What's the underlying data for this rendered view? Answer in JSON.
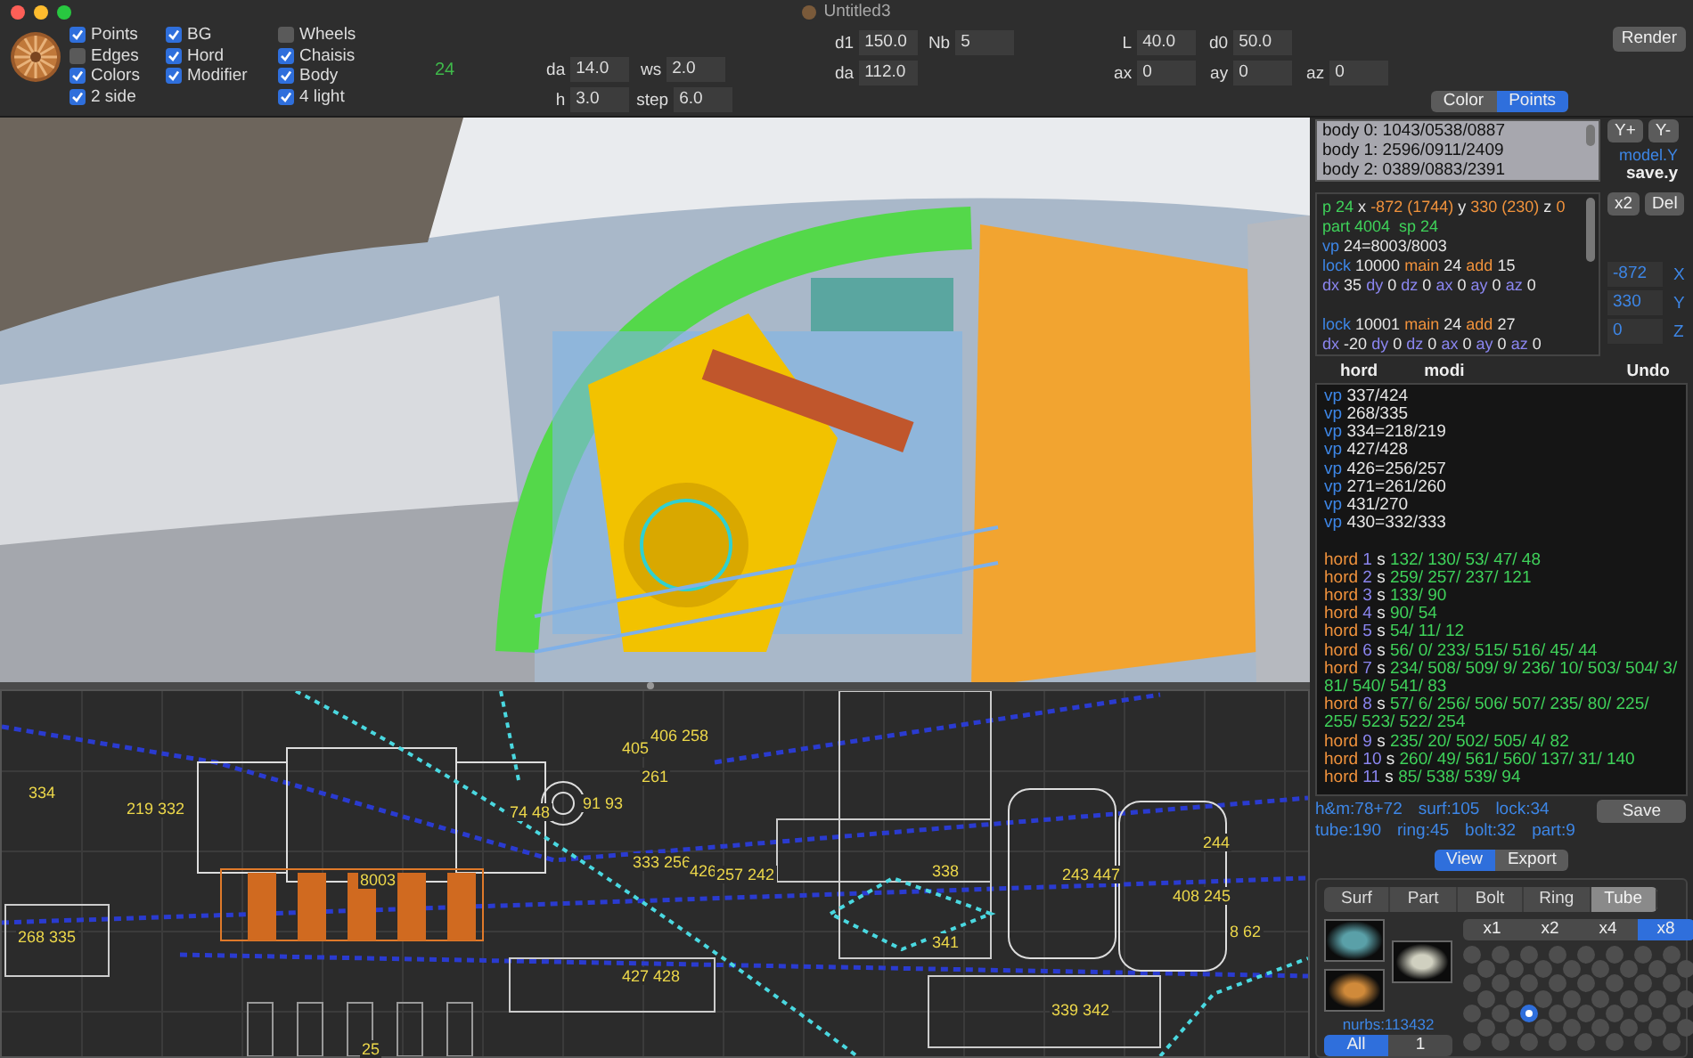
{
  "window": {
    "title": "Untitled3"
  },
  "toolbar": {
    "checkbox_columns": [
      [
        {
          "label": "Points",
          "checked": true
        },
        {
          "label": "Edges",
          "checked": false
        },
        {
          "label": "Colors",
          "checked": true
        },
        {
          "label": "2 side",
          "checked": true
        }
      ],
      [
        {
          "label": "BG",
          "checked": true
        },
        {
          "label": "Hord",
          "checked": true
        },
        {
          "label": "Modifier",
          "checked": true
        }
      ],
      [
        {
          "label": "Wheels",
          "checked": false
        },
        {
          "label": "Chaisis",
          "checked": true
        },
        {
          "label": "Body",
          "checked": true
        },
        {
          "label": "4 light",
          "checked": true
        }
      ]
    ],
    "count": "24",
    "field_groups": [
      {
        "rows": [
          [
            {
              "label": "da",
              "value": "14.0"
            },
            {
              "label": "ws",
              "value": "2.0"
            }
          ],
          [
            {
              "label": "h",
              "value": "3.0"
            },
            {
              "label": "step",
              "value": "6.0"
            }
          ]
        ]
      },
      {
        "rows": [
          [
            {
              "label": "d1",
              "value": "150.0"
            },
            {
              "label": "Nb",
              "value": "5"
            }
          ],
          [
            {
              "label": "da",
              "value": "112.0"
            }
          ]
        ]
      },
      {
        "rows": [
          [
            {
              "label": "L",
              "value": "40.0"
            },
            {
              "label": "d0",
              "value": "50.0"
            }
          ],
          [
            {
              "label": "ax",
              "value": "0"
            },
            {
              "label": "ay",
              "value": "0"
            },
            {
              "label": "az",
              "value": "0"
            }
          ]
        ]
      }
    ],
    "render_button": "Render"
  },
  "mode_tabs": [
    {
      "label": "Color",
      "selected": false
    },
    {
      "label": "Points",
      "selected": true
    }
  ],
  "wireframe": {
    "labels": [
      "334",
      "219 332",
      "74 48",
      "405",
      "406 258",
      "261",
      "91 93",
      "8003",
      "333 256",
      "426",
      "257 242",
      "338",
      "243 447",
      "244",
      "408 245",
      "8 62",
      "341",
      "268 335",
      "427 428",
      "339 342",
      "25"
    ]
  },
  "points_panel": {
    "bodies": [
      "body 0: 1043/0538/0887",
      "body 1: 2596/0911/2409",
      "body 2: 0389/0883/2391"
    ],
    "y_buttons": [
      "Y+",
      "Y-"
    ],
    "model_label": "model.Y",
    "save_label": "save.y",
    "info_blocks": [
      [
        [
          {
            "text": "p 24",
            "color": "#3fd25a"
          },
          {
            "text": "x",
            "color": "#e6e6e6"
          },
          {
            "text": "-872 (1744)",
            "color": "#f0923c"
          },
          {
            "text": "y",
            "color": "#e6e6e6"
          },
          {
            "text": "330 (230)",
            "color": "#f0923c"
          },
          {
            "text": "z",
            "color": "#e6e6e6"
          },
          {
            "text": "0",
            "color": "#f0923c"
          }
        ],
        [
          {
            "text": "part 4004  sp 24",
            "color": "#3fd25a"
          }
        ],
        [
          {
            "text": "vp",
            "color": "#3d86e6"
          },
          {
            "text": "24=8003/8003",
            "color": "#e6e6e6"
          }
        ],
        [
          {
            "text": "lock",
            "color": "#3d86e6"
          },
          {
            "text": "10000",
            "color": "#e6e6e6"
          },
          {
            "text": "main",
            "color": "#f0923c"
          },
          {
            "text": "24",
            "color": "#e6e6e6"
          },
          {
            "text": "add",
            "color": "#f0923c"
          },
          {
            "text": "15",
            "color": "#e6e6e6"
          }
        ],
        [
          {
            "text": "dx",
            "color": "#8b86f0"
          },
          {
            "text": "35",
            "color": "#e6e6e6"
          },
          {
            "text": "dy",
            "color": "#8b86f0"
          },
          {
            "text": "0",
            "color": "#e6e6e6"
          },
          {
            "text": "dz",
            "color": "#8b86f0"
          },
          {
            "text": "0",
            "color": "#e6e6e6"
          },
          {
            "text": "ax",
            "color": "#8b86f0"
          },
          {
            "text": "0",
            "color": "#e6e6e6"
          },
          {
            "text": "ay",
            "color": "#8b86f0"
          },
          {
            "text": "0",
            "color": "#e6e6e6"
          },
          {
            "text": "az",
            "color": "#8b86f0"
          },
          {
            "text": "0",
            "color": "#e6e6e6"
          }
        ]
      ],
      [
        [
          {
            "text": "lock",
            "color": "#3d86e6"
          },
          {
            "text": "10001",
            "color": "#e6e6e6"
          },
          {
            "text": "main",
            "color": "#f0923c"
          },
          {
            "text": "24",
            "color": "#e6e6e6"
          },
          {
            "text": "add",
            "color": "#f0923c"
          },
          {
            "text": "27",
            "color": "#e6e6e6"
          }
        ],
        [
          {
            "text": "dx",
            "color": "#8b86f0"
          },
          {
            "text": "-20",
            "color": "#e6e6e6"
          },
          {
            "text": "dy",
            "color": "#8b86f0"
          },
          {
            "text": "0",
            "color": "#e6e6e6"
          },
          {
            "text": "dz",
            "color": "#8b86f0"
          },
          {
            "text": "0",
            "color": "#e6e6e6"
          },
          {
            "text": "ax",
            "color": "#8b86f0"
          },
          {
            "text": "0",
            "color": "#e6e6e6"
          },
          {
            "text": "ay",
            "color": "#8b86f0"
          },
          {
            "text": "0",
            "color": "#e6e6e6"
          },
          {
            "text": "az",
            "color": "#8b86f0"
          },
          {
            "text": "0",
            "color": "#e6e6e6"
          }
        ]
      ]
    ],
    "action_buttons": [
      "x2",
      "Del"
    ],
    "coords": [
      {
        "value": "-872",
        "axis": "X"
      },
      {
        "value": "330",
        "axis": "Y"
      },
      {
        "value": "0",
        "axis": "Z"
      }
    ]
  },
  "log_header": [
    "hord",
    "modi",
    "Undo"
  ],
  "log_blocks": [
    [
      [
        {
          "text": "vp",
          "color": "#3d86e6"
        },
        {
          "text": "337/424",
          "color": "#e6e6e6"
        }
      ],
      [
        {
          "text": "vp",
          "color": "#3d86e6"
        },
        {
          "text": "268/335",
          "color": "#e6e6e6"
        }
      ],
      [
        {
          "text": "vp",
          "color": "#3d86e6"
        },
        {
          "text": "334=218/219",
          "color": "#e6e6e6"
        }
      ],
      [
        {
          "text": "vp",
          "color": "#3d86e6"
        },
        {
          "text": "427/428",
          "color": "#e6e6e6"
        }
      ],
      [
        {
          "text": "vp",
          "color": "#3d86e6"
        },
        {
          "text": "426=256/257",
          "color": "#e6e6e6"
        }
      ],
      [
        {
          "text": "vp",
          "color": "#3d86e6"
        },
        {
          "text": "271=261/260",
          "color": "#e6e6e6"
        }
      ],
      [
        {
          "text": "vp",
          "color": "#3d86e6"
        },
        {
          "text": "431/270",
          "color": "#e6e6e6"
        }
      ],
      [
        {
          "text": "vp",
          "color": "#3d86e6"
        },
        {
          "text": "430=332/333",
          "color": "#e6e6e6"
        }
      ]
    ],
    [
      [
        {
          "text": "hord",
          "color": "#f0923c"
        },
        {
          "text": "1",
          "color": "#8b86f0"
        },
        {
          "text": "s",
          "color": "#e6e6e6"
        },
        {
          "text": "132/ 130/ 53/ 47/ 48",
          "color": "#3fd25a"
        }
      ],
      [
        {
          "text": "hord",
          "color": "#f0923c"
        },
        {
          "text": "2",
          "color": "#8b86f0"
        },
        {
          "text": "s",
          "color": "#e6e6e6"
        },
        {
          "text": "259/ 257/ 237/ 121",
          "color": "#3fd25a"
        }
      ],
      [
        {
          "text": "hord",
          "color": "#f0923c"
        },
        {
          "text": "3",
          "color": "#8b86f0"
        },
        {
          "text": "s",
          "color": "#e6e6e6"
        },
        {
          "text": "133/ 90",
          "color": "#3fd25a"
        }
      ],
      [
        {
          "text": "hord",
          "color": "#f0923c"
        },
        {
          "text": "4",
          "color": "#8b86f0"
        },
        {
          "text": "s",
          "color": "#e6e6e6"
        },
        {
          "text": "90/ 54",
          "color": "#3fd25a"
        }
      ],
      [
        {
          "text": "hord",
          "color": "#f0923c"
        },
        {
          "text": "5",
          "color": "#8b86f0"
        },
        {
          "text": "s",
          "color": "#e6e6e6"
        },
        {
          "text": "54/ 11/ 12",
          "color": "#3fd25a"
        }
      ],
      [
        {
          "text": "hord",
          "color": "#f0923c"
        },
        {
          "text": "6",
          "color": "#8b86f0"
        },
        {
          "text": "s",
          "color": "#e6e6e6"
        },
        {
          "text": "56/ 0/ 233/ 515/ 516/ 45/ 44",
          "color": "#3fd25a"
        }
      ],
      [
        {
          "text": "hord",
          "color": "#f0923c"
        },
        {
          "text": "7",
          "color": "#8b86f0"
        },
        {
          "text": "s",
          "color": "#e6e6e6"
        },
        {
          "text": "234/ 508/ 509/ 9/ 236/ 10/ 503/ 504/ 3/ 81/ 540/ 541/ 83",
          "color": "#3fd25a"
        }
      ],
      [
        {
          "text": "hord",
          "color": "#f0923c"
        },
        {
          "text": "8",
          "color": "#8b86f0"
        },
        {
          "text": "s",
          "color": "#e6e6e6"
        },
        {
          "text": "57/ 6/ 256/ 506/ 507/ 235/ 80/ 225/ 255/ 523/ 522/ 254",
          "color": "#3fd25a"
        }
      ],
      [
        {
          "text": "hord",
          "color": "#f0923c"
        },
        {
          "text": "9",
          "color": "#8b86f0"
        },
        {
          "text": "s",
          "color": "#e6e6e6"
        },
        {
          "text": "235/ 20/ 502/ 505/ 4/ 82",
          "color": "#3fd25a"
        }
      ],
      [
        {
          "text": "hord",
          "color": "#f0923c"
        },
        {
          "text": "10",
          "color": "#8b86f0"
        },
        {
          "text": "s",
          "color": "#e6e6e6"
        },
        {
          "text": "260/ 49/ 561/ 560/ 137/ 31/ 140",
          "color": "#3fd25a"
        }
      ],
      [
        {
          "text": "hord",
          "color": "#f0923c"
        },
        {
          "text": "11",
          "color": "#8b86f0"
        },
        {
          "text": "s",
          "color": "#e6e6e6"
        },
        {
          "text": "85/ 538/ 539/ 94",
          "color": "#3fd25a"
        }
      ]
    ]
  ],
  "stats": [
    [
      "h&m:78+72",
      "surf:105",
      "lock:34"
    ],
    [
      "tube:190",
      "ring:45",
      "bolt:32",
      "part:9"
    ]
  ],
  "save_button": "Save",
  "view_tabs": [
    {
      "label": "View",
      "selected": true
    },
    {
      "label": "Export",
      "selected": false
    }
  ],
  "object_tabs": [
    {
      "label": "Surf",
      "selected": false
    },
    {
      "label": "Part",
      "selected": false
    },
    {
      "label": "Bolt",
      "selected": false
    },
    {
      "label": "Ring",
      "selected": false
    },
    {
      "label": "Tube",
      "selected": true
    }
  ],
  "nurbs": "nurbs:113432",
  "scope_tabs": [
    {
      "label": "All",
      "selected": true
    },
    {
      "label": "1",
      "selected": false
    }
  ],
  "zoom_tabs": [
    {
      "label": "x1",
      "selected": false
    },
    {
      "label": "x2",
      "selected": false
    },
    {
      "label": "x4",
      "selected": false
    },
    {
      "label": "x8",
      "selected": true
    }
  ],
  "dot_grid": [
    [
      {
        "selected": false
      },
      {
        "selected": false
      },
      {
        "selected": false
      },
      {
        "selected": false
      },
      {
        "selected": false
      },
      {
        "selected": false
      },
      {
        "selected": false
      },
      {
        "selected": false
      }
    ],
    [
      {
        "selected": false
      },
      {
        "selected": false
      },
      {
        "selected": false
      },
      {
        "selected": false
      },
      {
        "selected": false
      },
      {
        "selected": false
      },
      {
        "selected": false
      },
      {
        "selected": false
      }
    ],
    [
      {
        "selected": false
      },
      {
        "selected": false
      },
      {
        "selected": false
      },
      {
        "selected": false
      },
      {
        "selected": false
      },
      {
        "selected": false
      },
      {
        "selected": false
      },
      {
        "selected": false
      }
    ],
    [
      {
        "selected": false
      },
      {
        "selected": false
      },
      {
        "selected": false
      },
      {
        "selected": false
      },
      {
        "selected": false
      },
      {
        "selected": false
      },
      {
        "selected": false
      },
      {
        "selected": false
      }
    ],
    [
      {
        "selected": false
      },
      {
        "selected": false
      },
      {
        "selected": true
      },
      {
        "selected": false
      },
      {
        "selected": false
      },
      {
        "selected": false
      },
      {
        "selected": false
      },
      {
        "selected": false
      }
    ],
    [
      {
        "selected": false
      },
      {
        "selected": false
      },
      {
        "selected": false
      },
      {
        "selected": false
      },
      {
        "selected": false
      },
      {
        "selected": false
      },
      {
        "selected": false
      },
      {
        "selected": false
      }
    ],
    [
      {
        "selected": false
      },
      {
        "selected": false
      },
      {
        "selected": false
      },
      {
        "selected": false
      },
      {
        "selected": false
      },
      {
        "selected": false
      },
      {
        "selected": false
      },
      {
        "selected": false
      }
    ]
  ]
}
